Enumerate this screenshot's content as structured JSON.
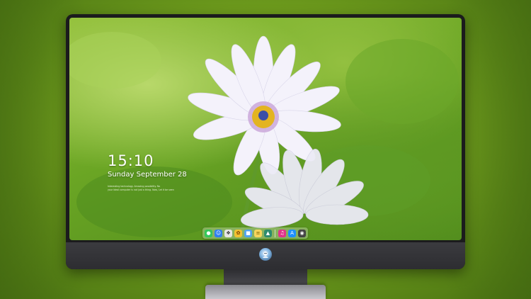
{
  "lock_screen": {
    "time": "15:10",
    "date": "Sunday September 28",
    "note_line1": "Interesting technology. Amazing possibility. No",
    "note_line2": "your ideal computer is not just a thing. Now, Let it be seen"
  },
  "dock": {
    "icons": [
      {
        "name": "messages-icon",
        "color": "#34c759"
      },
      {
        "name": "finder-icon",
        "color": "#2f7ff0"
      },
      {
        "name": "compass-icon",
        "color": "#e6e6e6"
      },
      {
        "name": "photos-icon",
        "color": "#f2c230"
      },
      {
        "name": "clapperboard-icon",
        "color": "#4ea3f0"
      },
      {
        "name": "notes-icon",
        "color": "#f6d55c"
      },
      {
        "name": "gallery-icon",
        "color": "#2d8c6e"
      },
      {
        "name": "music-icon",
        "color": "#e0338a"
      },
      {
        "name": "app-store-icon",
        "color": "#1e90ff"
      },
      {
        "name": "camera-icon",
        "color": "#444444"
      }
    ]
  },
  "monitor": {
    "logo_name": "brand-logo-icon"
  }
}
